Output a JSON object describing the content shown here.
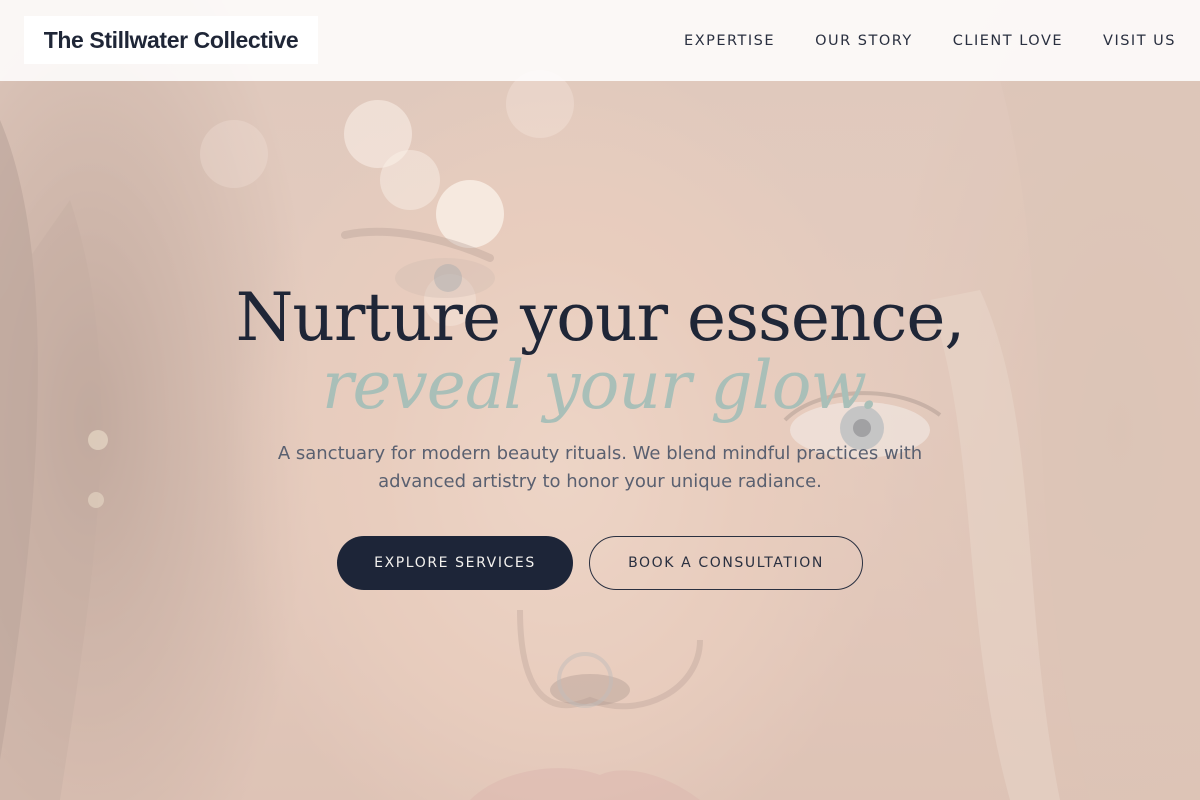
{
  "header": {
    "logo_text": "The Stillwater Collective",
    "nav": [
      {
        "label": "EXPERTISE"
      },
      {
        "label": "OUR STORY"
      },
      {
        "label": "CLIENT LOVE"
      },
      {
        "label": "VISIT US"
      }
    ]
  },
  "hero": {
    "headline_line1": "Nurture your essence,",
    "headline_line2": "reveal your glow.",
    "subtitle": "A sanctuary for modern beauty rituals. We blend mindful practices with advanced artistry to honor your unique radiance.",
    "primary_cta": "EXPLORE SERVICES",
    "secondary_cta": "BOOK A CONSULTATION"
  },
  "colors": {
    "navy": "#1d2538",
    "sage_accent": "#a9bfb8",
    "text_muted": "#5a6070"
  }
}
